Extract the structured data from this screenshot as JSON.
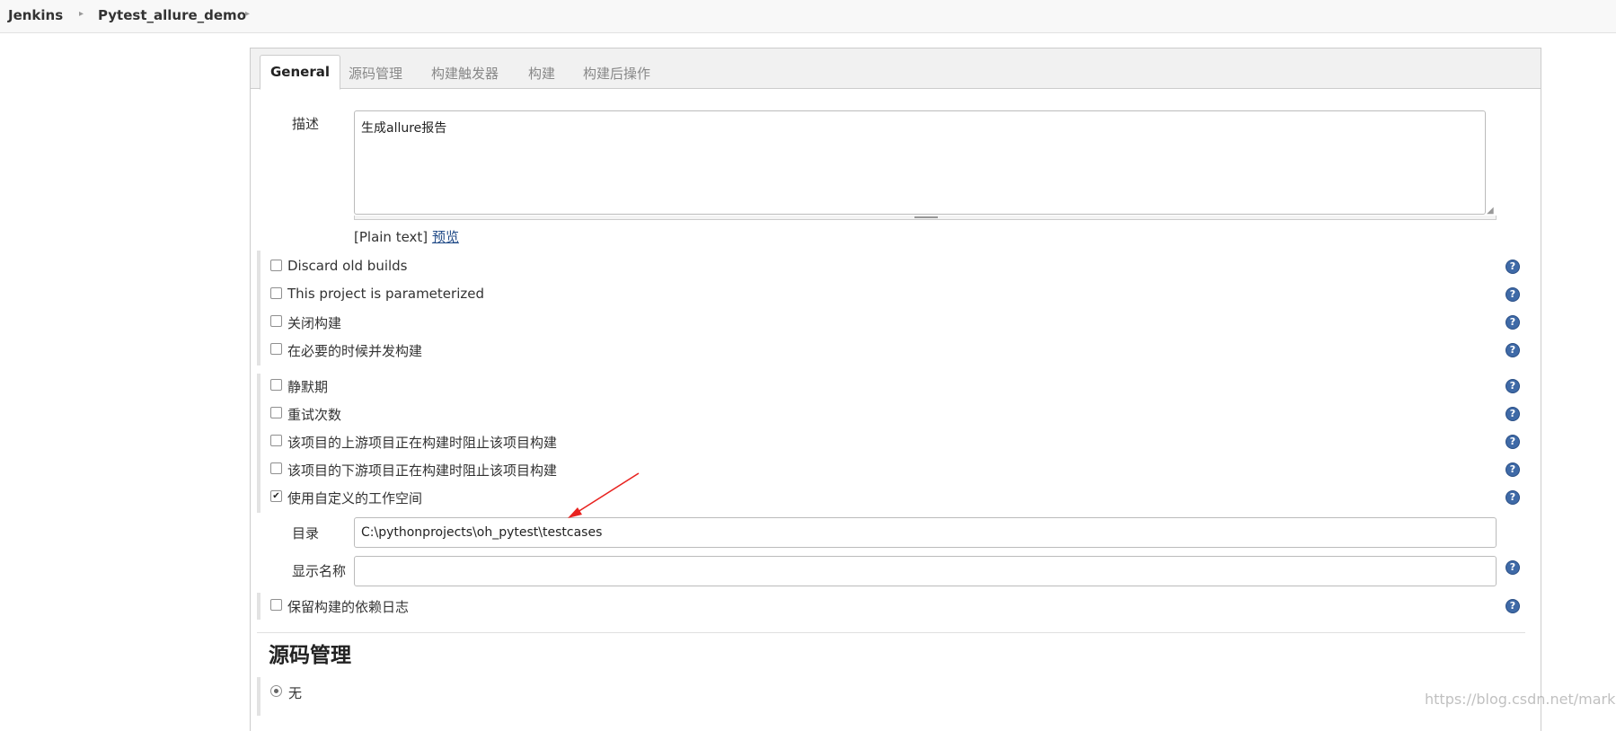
{
  "breadcrumb": {
    "root": "Jenkins",
    "project": "Pytest_allure_demo",
    "separator": "▸"
  },
  "tabs": [
    "General",
    "源码管理",
    "构建触发器",
    "构建",
    "构建后操作"
  ],
  "description": {
    "label": "描述",
    "value": "生成allure报告",
    "format_note": "[Plain text]",
    "preview_link": "预览"
  },
  "options_group_1": [
    {
      "label": "Discard old builds",
      "checked": false
    },
    {
      "label": "This project is parameterized",
      "checked": false
    },
    {
      "label": "关闭构建",
      "checked": false
    },
    {
      "label": "在必要的时候并发构建",
      "checked": false
    }
  ],
  "options_group_2": [
    {
      "label": "静默期",
      "checked": false
    },
    {
      "label": "重试次数",
      "checked": false
    },
    {
      "label": "该项目的上游项目正在构建时阻止该项目构建",
      "checked": false
    },
    {
      "label": "该项目的下游项目正在构建时阻止该项目构建",
      "checked": false
    },
    {
      "label": "使用自定义的工作空间",
      "checked": true
    }
  ],
  "custom_workspace": {
    "directory_label": "目录",
    "directory_value": "C:\\pythonprojects\\oh_pytest\\testcases",
    "display_name_label": "显示名称",
    "display_name_value": ""
  },
  "keep_dependencies": {
    "label": "保留构建的依赖日志",
    "checked": false
  },
  "scm": {
    "heading": "源码管理",
    "option_none": "无",
    "selected": true
  },
  "help_icon_glyph": "?",
  "checkmark_glyph": "✔",
  "watermark": "https://blog.csdn.net/markbobobo",
  "colors": {
    "link": "#204a87",
    "help_icon": "#3f6aa7",
    "annotation_arrow": "#e8221f"
  }
}
